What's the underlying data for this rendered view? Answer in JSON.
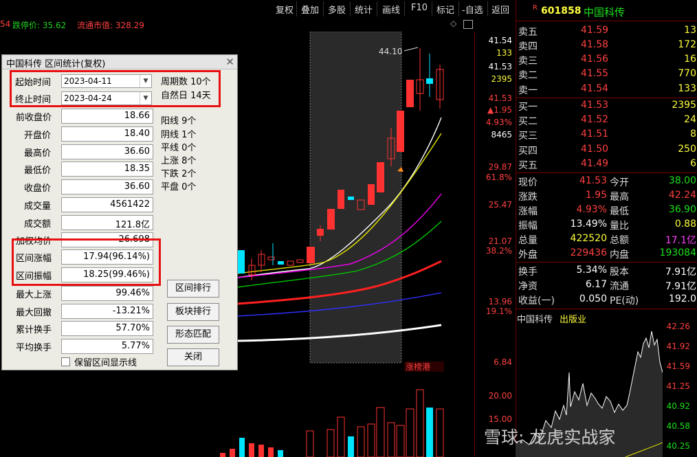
{
  "toolbar": {
    "items": [
      "复权",
      "叠加",
      "多股",
      "统计",
      "画线",
      "F10",
      "标记",
      "-自选",
      "返回"
    ]
  },
  "infoline": {
    "prefix": "54",
    "limit_down": "跌停价: 35.62",
    "float_mv": "流通市值: 328.29"
  },
  "chart": {
    "peak_label": "44.10",
    "badge": "涨榜港",
    "right_axis": {
      "top_price": "41.54",
      "top_vol": "133",
      "price2": "41.53",
      "vol2": "2395",
      "price3": "41.53",
      "change": "▲1.95",
      "change_pct": "4.93%",
      "vol3": "8465",
      "t1": "29.87",
      "t1p": "61.8%",
      "t2": "25.47",
      "t3": "21.07",
      "t3p": "38.2%",
      "t4": "13.96",
      "t4p": "19.1%",
      "t5": "6.84",
      "v1": "20.00",
      "v2": "15.00"
    }
  },
  "dialog": {
    "title": "中国科传 区间统计(复权)",
    "start_label": "起始时间",
    "start_value": "2023-04-11",
    "end_label": "终止时间",
    "end_value": "2023-04-24",
    "period_count": "周期数 10个",
    "natural_days": "自然日 14天",
    "rows": [
      {
        "label": "前收盘价",
        "value": "18.66"
      },
      {
        "label": "开盘价",
        "value": "18.40"
      },
      {
        "label": "最高价",
        "value": "36.60"
      },
      {
        "label": "最低价",
        "value": "18.35"
      },
      {
        "label": "收盘价",
        "value": "36.60"
      },
      {
        "label": "成交量",
        "value": "4561422"
      },
      {
        "label": "成交额",
        "value": "121.8亿"
      },
      {
        "label": "加权均价",
        "value": "26.698"
      },
      {
        "label": "区间涨幅",
        "value": "17.94(96.14%)"
      },
      {
        "label": "区间振幅",
        "value": "18.25(99.46%)"
      },
      {
        "label": "最大上涨",
        "value": "99.46%"
      },
      {
        "label": "最大回撤",
        "value": "-13.21%"
      },
      {
        "label": "累计换手",
        "value": "57.70%"
      },
      {
        "label": "平均换手",
        "value": "5.77%"
      }
    ],
    "stats": [
      "阳线 9个",
      "阴线 1个",
      "平线 0个",
      "上涨 8个",
      "下跌 2个",
      "平盘 0个"
    ],
    "buttons": {
      "range_rank": "区间排行",
      "sector_rank": "板块排行",
      "pattern_match": "形态匹配",
      "close": "关闭"
    },
    "keep_range_label": "保留区间显示线"
  },
  "quote": {
    "code": "601858",
    "name": "中国科传",
    "sells": [
      {
        "label": "卖五",
        "price": "41.59",
        "vol": "13"
      },
      {
        "label": "卖四",
        "price": "41.58",
        "vol": "172"
      },
      {
        "label": "卖三",
        "price": "41.56",
        "vol": "16"
      },
      {
        "label": "卖二",
        "price": "41.55",
        "vol": "770"
      },
      {
        "label": "卖一",
        "price": "41.54",
        "vol": "133"
      }
    ],
    "buys": [
      {
        "label": "买一",
        "price": "41.53",
        "vol": "2395"
      },
      {
        "label": "买二",
        "price": "41.52",
        "vol": "24"
      },
      {
        "label": "买三",
        "price": "41.51",
        "vol": "8"
      },
      {
        "label": "买四",
        "price": "41.50",
        "vol": "250"
      },
      {
        "label": "买五",
        "price": "41.49",
        "vol": "6"
      }
    ],
    "stats": [
      {
        "l1": "现价",
        "v1": "41.53",
        "l2": "今开",
        "v2": "38.00"
      },
      {
        "l1": "涨跌",
        "v1": "1.95",
        "l2": "最高",
        "v2": "42.24"
      },
      {
        "l1": "涨幅",
        "v1": "4.93%",
        "l2": "最低",
        "v2": "36.90"
      },
      {
        "l1": "振幅",
        "v1": "13.49%",
        "l2": "量比",
        "v2": "0.88"
      },
      {
        "l1": "总量",
        "v1": "422520",
        "l2": "总额",
        "v2": "17.1亿"
      },
      {
        "l1": "外盘",
        "v1": "229436",
        "l2": "内盘",
        "v2": "193084"
      }
    ],
    "stats2": [
      {
        "l1": "换手",
        "v1": "5.34%",
        "l2": "股本",
        "v2": "7.91亿"
      },
      {
        "l1": "净资",
        "v1": "6.17",
        "l2": "流通",
        "v2": "7.91亿"
      },
      {
        "l1": "收益(一)",
        "v1": "0.050",
        "l2": "PE(动)",
        "v2": "192.0"
      }
    ]
  },
  "mini_chart": {
    "name": "中国科传",
    "tag": "出版业",
    "axis": [
      "42.26",
      "41.92",
      "41.59",
      "41.25",
      "40.92",
      "40.58",
      "40.25"
    ]
  },
  "watermark": {
    "text": "雪球: 龙虎实战家"
  },
  "colors": {
    "up": "#ff3232",
    "down": "#00e5ff",
    "ma5": "#ffffff",
    "ma10": "#e6e600",
    "ma20": "#ff00ff",
    "ma30": "#00c800",
    "ma60": "#ff2020",
    "ma120": "#3030ff",
    "ma250": "#ffffff"
  }
}
